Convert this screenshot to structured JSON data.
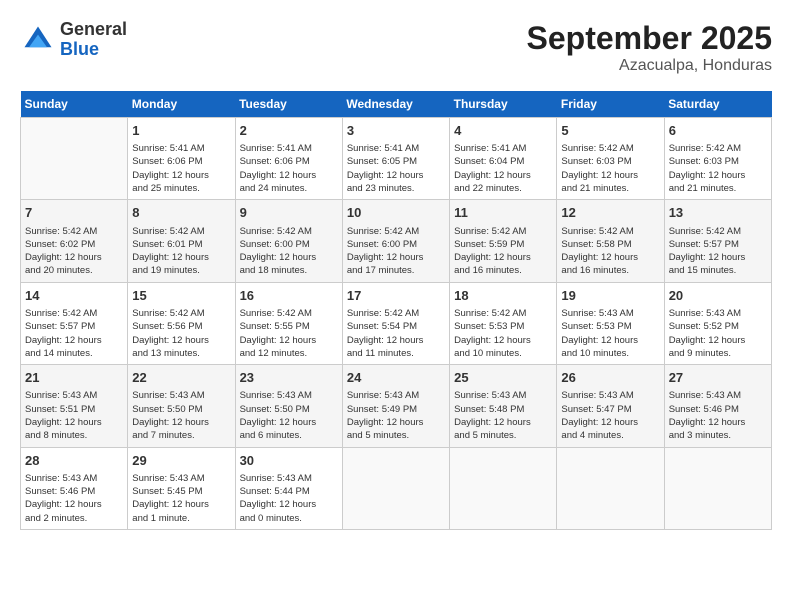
{
  "logo": {
    "line1": "General",
    "line2": "Blue"
  },
  "header": {
    "month": "September 2025",
    "location": "Azacualpa, Honduras"
  },
  "days_of_week": [
    "Sunday",
    "Monday",
    "Tuesday",
    "Wednesday",
    "Thursday",
    "Friday",
    "Saturday"
  ],
  "weeks": [
    [
      {
        "day": "",
        "info": ""
      },
      {
        "day": "1",
        "info": "Sunrise: 5:41 AM\nSunset: 6:06 PM\nDaylight: 12 hours\nand 25 minutes."
      },
      {
        "day": "2",
        "info": "Sunrise: 5:41 AM\nSunset: 6:06 PM\nDaylight: 12 hours\nand 24 minutes."
      },
      {
        "day": "3",
        "info": "Sunrise: 5:41 AM\nSunset: 6:05 PM\nDaylight: 12 hours\nand 23 minutes."
      },
      {
        "day": "4",
        "info": "Sunrise: 5:41 AM\nSunset: 6:04 PM\nDaylight: 12 hours\nand 22 minutes."
      },
      {
        "day": "5",
        "info": "Sunrise: 5:42 AM\nSunset: 6:03 PM\nDaylight: 12 hours\nand 21 minutes."
      },
      {
        "day": "6",
        "info": "Sunrise: 5:42 AM\nSunset: 6:03 PM\nDaylight: 12 hours\nand 21 minutes."
      }
    ],
    [
      {
        "day": "7",
        "info": "Sunrise: 5:42 AM\nSunset: 6:02 PM\nDaylight: 12 hours\nand 20 minutes."
      },
      {
        "day": "8",
        "info": "Sunrise: 5:42 AM\nSunset: 6:01 PM\nDaylight: 12 hours\nand 19 minutes."
      },
      {
        "day": "9",
        "info": "Sunrise: 5:42 AM\nSunset: 6:00 PM\nDaylight: 12 hours\nand 18 minutes."
      },
      {
        "day": "10",
        "info": "Sunrise: 5:42 AM\nSunset: 6:00 PM\nDaylight: 12 hours\nand 17 minutes."
      },
      {
        "day": "11",
        "info": "Sunrise: 5:42 AM\nSunset: 5:59 PM\nDaylight: 12 hours\nand 16 minutes."
      },
      {
        "day": "12",
        "info": "Sunrise: 5:42 AM\nSunset: 5:58 PM\nDaylight: 12 hours\nand 16 minutes."
      },
      {
        "day": "13",
        "info": "Sunrise: 5:42 AM\nSunset: 5:57 PM\nDaylight: 12 hours\nand 15 minutes."
      }
    ],
    [
      {
        "day": "14",
        "info": "Sunrise: 5:42 AM\nSunset: 5:57 PM\nDaylight: 12 hours\nand 14 minutes."
      },
      {
        "day": "15",
        "info": "Sunrise: 5:42 AM\nSunset: 5:56 PM\nDaylight: 12 hours\nand 13 minutes."
      },
      {
        "day": "16",
        "info": "Sunrise: 5:42 AM\nSunset: 5:55 PM\nDaylight: 12 hours\nand 12 minutes."
      },
      {
        "day": "17",
        "info": "Sunrise: 5:42 AM\nSunset: 5:54 PM\nDaylight: 12 hours\nand 11 minutes."
      },
      {
        "day": "18",
        "info": "Sunrise: 5:42 AM\nSunset: 5:53 PM\nDaylight: 12 hours\nand 10 minutes."
      },
      {
        "day": "19",
        "info": "Sunrise: 5:43 AM\nSunset: 5:53 PM\nDaylight: 12 hours\nand 10 minutes."
      },
      {
        "day": "20",
        "info": "Sunrise: 5:43 AM\nSunset: 5:52 PM\nDaylight: 12 hours\nand 9 minutes."
      }
    ],
    [
      {
        "day": "21",
        "info": "Sunrise: 5:43 AM\nSunset: 5:51 PM\nDaylight: 12 hours\nand 8 minutes."
      },
      {
        "day": "22",
        "info": "Sunrise: 5:43 AM\nSunset: 5:50 PM\nDaylight: 12 hours\nand 7 minutes."
      },
      {
        "day": "23",
        "info": "Sunrise: 5:43 AM\nSunset: 5:50 PM\nDaylight: 12 hours\nand 6 minutes."
      },
      {
        "day": "24",
        "info": "Sunrise: 5:43 AM\nSunset: 5:49 PM\nDaylight: 12 hours\nand 5 minutes."
      },
      {
        "day": "25",
        "info": "Sunrise: 5:43 AM\nSunset: 5:48 PM\nDaylight: 12 hours\nand 5 minutes."
      },
      {
        "day": "26",
        "info": "Sunrise: 5:43 AM\nSunset: 5:47 PM\nDaylight: 12 hours\nand 4 minutes."
      },
      {
        "day": "27",
        "info": "Sunrise: 5:43 AM\nSunset: 5:46 PM\nDaylight: 12 hours\nand 3 minutes."
      }
    ],
    [
      {
        "day": "28",
        "info": "Sunrise: 5:43 AM\nSunset: 5:46 PM\nDaylight: 12 hours\nand 2 minutes."
      },
      {
        "day": "29",
        "info": "Sunrise: 5:43 AM\nSunset: 5:45 PM\nDaylight: 12 hours\nand 1 minute."
      },
      {
        "day": "30",
        "info": "Sunrise: 5:43 AM\nSunset: 5:44 PM\nDaylight: 12 hours\nand 0 minutes."
      },
      {
        "day": "",
        "info": ""
      },
      {
        "day": "",
        "info": ""
      },
      {
        "day": "",
        "info": ""
      },
      {
        "day": "",
        "info": ""
      }
    ]
  ]
}
